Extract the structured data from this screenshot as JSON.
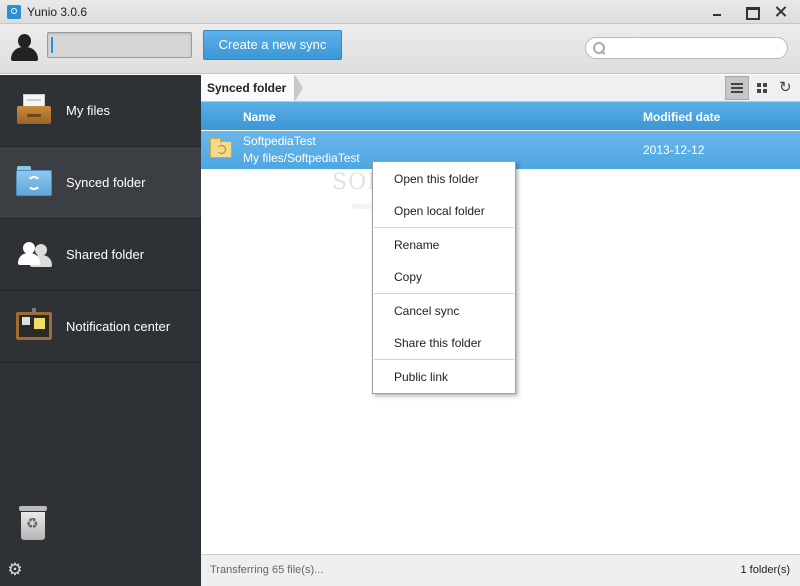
{
  "window": {
    "title": "Yunio 3.0.6"
  },
  "toolbar": {
    "create_label": "Create a new sync",
    "user_value": "",
    "search_placeholder": ""
  },
  "sidebar": {
    "items": [
      {
        "label": "My files",
        "icon": "files-tray-icon"
      },
      {
        "label": "Synced folder",
        "icon": "synced-folder-icon"
      },
      {
        "label": "Shared folder",
        "icon": "shared-folder-icon"
      },
      {
        "label": "Notification center",
        "icon": "notification-board-icon"
      }
    ],
    "active": "Synced folder"
  },
  "breadcrumb": {
    "current": "Synced folder"
  },
  "table": {
    "headers": {
      "name": "Name",
      "modified": "Modified date"
    },
    "rows": [
      {
        "name": "SoftpediaTest",
        "path": "My files/SoftpediaTest",
        "modified": "2013-12-12",
        "selected": true
      }
    ]
  },
  "context_menu": {
    "items": [
      "Open this folder",
      "Open local folder",
      "Rename",
      "Copy",
      "Cancel sync",
      "Share this folder",
      "Public link"
    ]
  },
  "status": {
    "left": "Transferring 65 file(s)...",
    "right": "1 folder(s)"
  },
  "watermark": {
    "text": "SOFTPEDIA",
    "url": "www.softpedia.com"
  },
  "colors": {
    "accent": "#3b96d5",
    "sidebar": "#2e3135",
    "button": "#4aa5e0"
  }
}
